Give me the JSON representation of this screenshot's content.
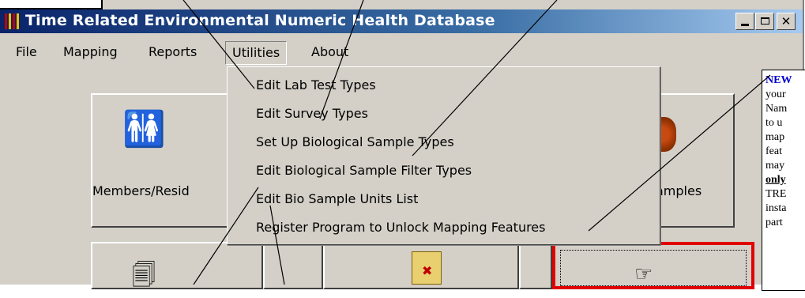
{
  "window": {
    "title": "Time Related Environmental Numeric Health Database"
  },
  "menubar": {
    "items": [
      "File",
      "Mapping",
      "Reports",
      "Utilities",
      "About"
    ]
  },
  "utilities_menu": {
    "items": [
      "Edit Lab Test Types",
      "Edit Survey Types",
      "Set Up Biological Sample Types",
      "Edit Biological Sample Filter Types",
      "Edit Bio Sample Units List",
      "Register Program to Unlock Mapping Features"
    ]
  },
  "main": {
    "members_button_label": "Members/Resid",
    "samples_button_label": "amples"
  },
  "callout": {
    "lines": [
      "NEW",
      "your",
      "Nam",
      "to u",
      "map",
      "feat",
      "may",
      "only",
      "TRE",
      "insta",
      "part"
    ]
  },
  "colors": {
    "title_bar_start": "#0a246a",
    "title_bar_end": "#a6caf0",
    "window_face": "#d4d0c8",
    "highlight_border": "#e00000",
    "callout_accent": "#0000cc"
  },
  "icons": {
    "app": "app-icon",
    "members": "people-icon",
    "documents": "document-icon",
    "map": "map-icon",
    "pointer": "hand-pointer-icon"
  }
}
